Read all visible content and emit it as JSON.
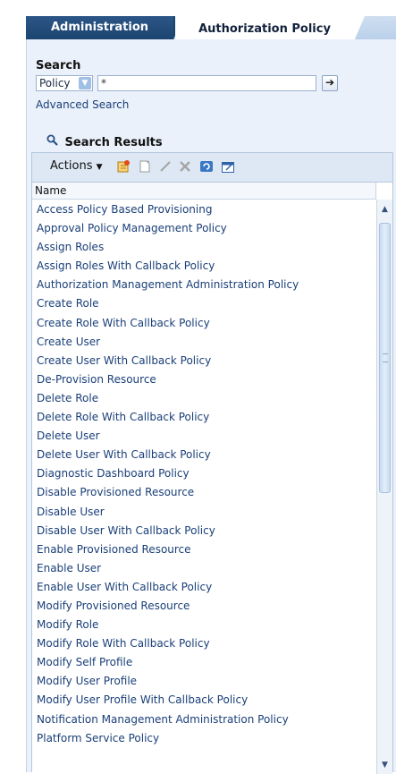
{
  "tabs": [
    {
      "label": "Administration",
      "active": false
    },
    {
      "label": "Authorization Policy",
      "active": true
    }
  ],
  "search": {
    "label": "Search",
    "type_value": "Policy",
    "query_value": "*",
    "advanced_link": "Advanced Search"
  },
  "results": {
    "heading": "Search Results",
    "actions_label": "Actions",
    "column_header": "Name",
    "rows": [
      "Access Policy Based Provisioning",
      "Approval Policy Management Policy",
      "Assign Roles",
      "Assign Roles With Callback Policy",
      "Authorization Management Administration Policy",
      "Create Role",
      "Create Role With Callback Policy",
      "Create User",
      "Create User With Callback Policy",
      "De-Provision Resource",
      "Delete Role",
      "Delete Role With Callback Policy",
      "Delete User",
      "Delete User With Callback Policy",
      "Diagnostic Dashboard Policy",
      "Disable Provisioned Resource",
      "Disable User",
      "Disable User With Callback Policy",
      "Enable Provisioned Resource",
      "Enable User",
      "Enable User With Callback Policy",
      "Modify Provisioned Resource",
      "Modify Role",
      "Modify Role With Callback Policy",
      "Modify Self Profile",
      "Modify User Profile",
      "Modify User Profile With Callback Policy",
      "Notification Management Administration Policy",
      "Platform Service Policy"
    ]
  },
  "icons": {
    "search": "magnifier-icon",
    "go": "arrow-right-icon",
    "toolbar": [
      "create-policy-icon",
      "new-icon",
      "edit-icon",
      "delete-icon",
      "refresh-icon",
      "detach-icon"
    ]
  },
  "colors": {
    "active_tab_bg": "#ffffff",
    "inactive_tab_bg": "#1c4470",
    "panel_bg": "#eaf1fa",
    "link": "#1a3f78"
  }
}
